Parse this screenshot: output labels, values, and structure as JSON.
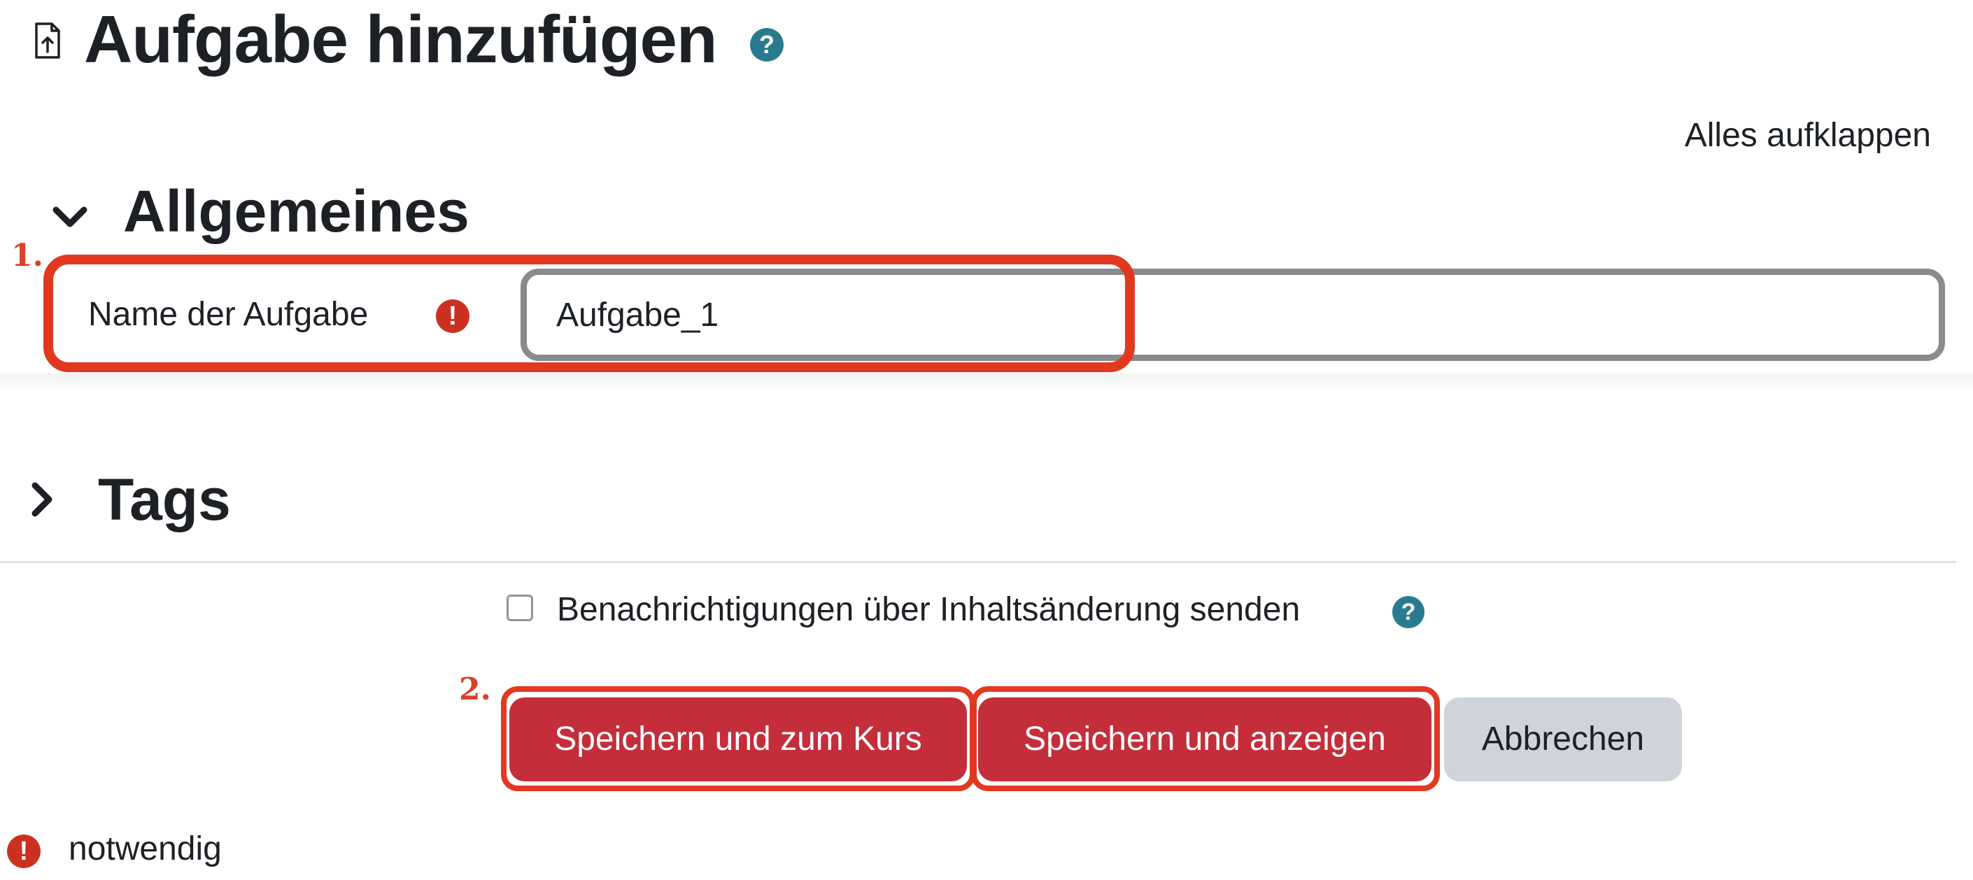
{
  "header": {
    "title": "Aufgabe hinzufügen",
    "help_icon": "question-circle-icon",
    "page_icon": "assignment-file-icon"
  },
  "form": {
    "expand_all_label": "Alles aufklappen",
    "sections": [
      {
        "title": "Allgemeines",
        "state": "expanded",
        "toggle_icon": "chevron-down-icon"
      },
      {
        "title": "Tags",
        "state": "collapsed",
        "toggle_icon": "chevron-right-icon"
      }
    ],
    "name_field": {
      "label": "Name der Aufgabe",
      "required_icon": "exclamation-circle-icon",
      "value": "Aufgabe_1"
    },
    "notify": {
      "label": "Benachrichtigungen über Inhaltsänderung senden",
      "checked": false,
      "help_icon": "question-circle-icon"
    },
    "buttons": {
      "save_return": "Speichern und zum Kurs",
      "save_display": "Speichern und anzeigen",
      "cancel": "Abbrechen"
    },
    "required_note": "notwendig"
  },
  "annotations": {
    "step1": "1.",
    "step2": "2.",
    "color": "#e2381f"
  },
  "colors": {
    "primary_button": "#c42d3a",
    "secondary_button": "#ced4da",
    "required": "#ca3120",
    "help": "#2a7a8f"
  }
}
